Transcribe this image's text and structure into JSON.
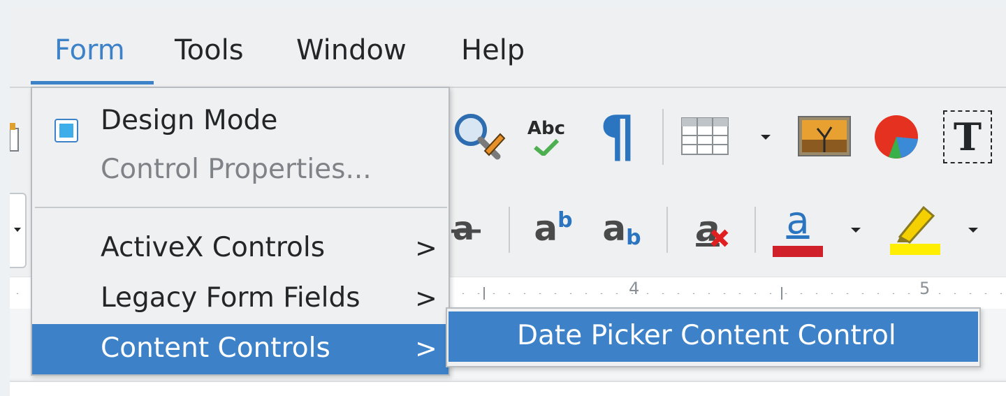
{
  "menubar": {
    "items": [
      {
        "label": "Form",
        "active": true
      },
      {
        "label": "Tools",
        "active": false
      },
      {
        "label": "Window",
        "active": false
      },
      {
        "label": "Help",
        "active": false
      }
    ]
  },
  "form_menu": {
    "items": [
      {
        "label": "Design Mode",
        "checked": true,
        "enabled": true
      },
      {
        "label": "Control Properties...",
        "enabled": false
      },
      {
        "label": "ActiveX Controls",
        "submenu": true
      },
      {
        "label": "Legacy Form Fields",
        "submenu": true
      },
      {
        "label": "Content Controls",
        "submenu": true,
        "highlighted": true
      }
    ],
    "chevron": ">"
  },
  "content_controls_submenu": {
    "items": [
      {
        "label": "Date Picker Content Control",
        "highlighted": true
      }
    ]
  },
  "toolbar": {
    "row1": {
      "spelling_icon_text": "Abc",
      "formatting_marks_glyph": "¶",
      "textbox_glyph": "T",
      "icons": [
        "find-replace-icon",
        "spelling-icon",
        "formatting-marks-icon",
        "insert-table-icon",
        "insert-image-icon",
        "insert-chart-icon",
        "insert-textbox-icon"
      ]
    },
    "row2": {
      "superscript_base": "a",
      "superscript_mark": "b",
      "subscript_base": "a",
      "subscript_mark": "b",
      "clear_format_glyph": "a",
      "font_color_glyph": "a",
      "icons": [
        "strikethrough-icon",
        "superscript-icon",
        "subscript-icon",
        "clear-formatting-icon",
        "font-color-icon",
        "highlight-icon"
      ],
      "font_color": "#d0202a",
      "highlight_color": "#ffee00"
    }
  },
  "ruler": {
    "labels": [
      "4",
      "5"
    ]
  },
  "colors": {
    "accent": "#3d82c8",
    "menu_bg": "#eff0f1",
    "checkbox_fill": "#3daee9"
  }
}
